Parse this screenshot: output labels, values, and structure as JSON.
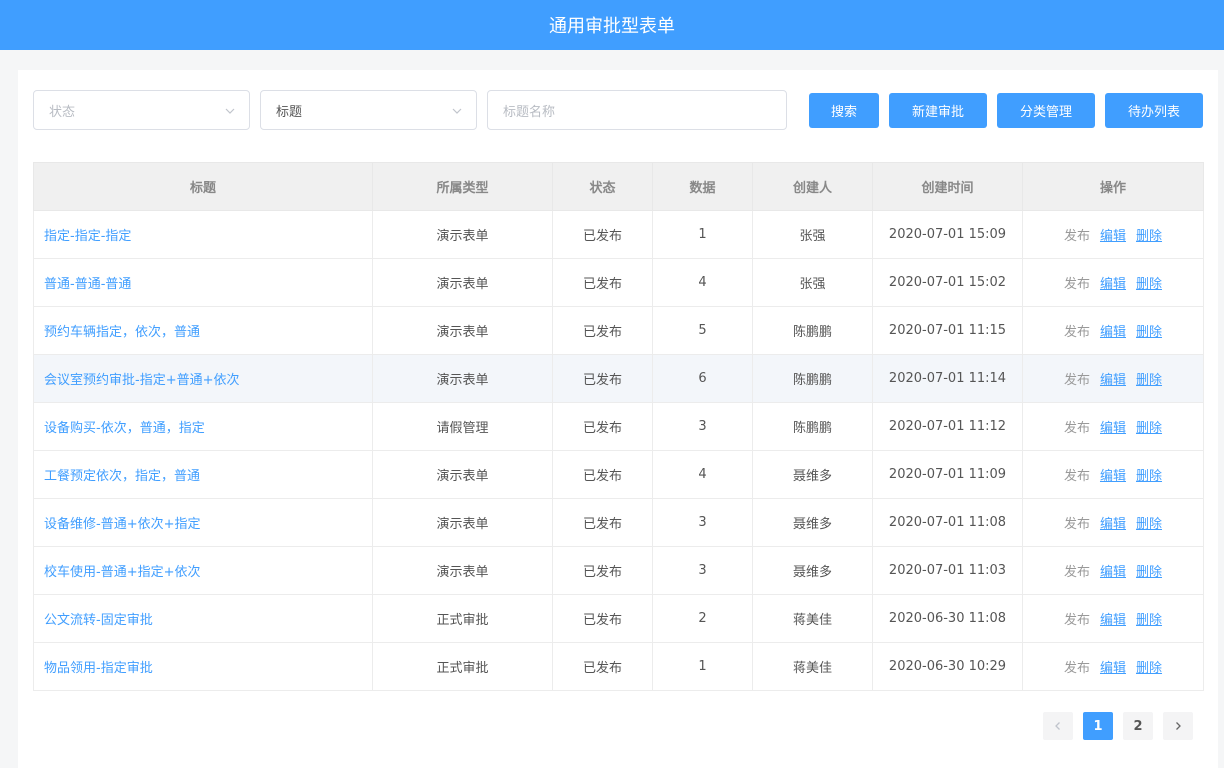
{
  "header": {
    "title": "通用审批型表单"
  },
  "filters": {
    "status_placeholder": "状态",
    "field_value": "标题",
    "keyword_placeholder": "标题名称"
  },
  "buttons": {
    "search": "搜索",
    "new_approval": "新建审批",
    "category_manage": "分类管理",
    "todo_list": "待办列表"
  },
  "table": {
    "columns": [
      "标题",
      "所属类型",
      "状态",
      "数据",
      "创建人",
      "创建时间",
      "操作"
    ],
    "rows": [
      {
        "title": "指定-指定-指定",
        "type": "演示表单",
        "status": "已发布",
        "count": "1",
        "creator": "张强",
        "created": "2020-07-01 15:09",
        "op_publish": "发布",
        "op_edit": "编辑",
        "op_delete": "删除"
      },
      {
        "title": "普通-普通-普通",
        "type": "演示表单",
        "status": "已发布",
        "count": "4",
        "creator": "张强",
        "created": "2020-07-01 15:02",
        "op_publish": "发布",
        "op_edit": "编辑",
        "op_delete": "删除"
      },
      {
        "title": "预约车辆指定，依次，普通",
        "type": "演示表单",
        "status": "已发布",
        "count": "5",
        "creator": "陈鹏鹏",
        "created": "2020-07-01 11:15",
        "op_publish": "发布",
        "op_edit": "编辑",
        "op_delete": "删除"
      },
      {
        "title": "会议室预约审批-指定+普通+依次",
        "type": "演示表单",
        "status": "已发布",
        "count": "6",
        "creator": "陈鹏鹏",
        "created": "2020-07-01 11:14",
        "op_publish": "发布",
        "op_edit": "编辑",
        "op_delete": "删除"
      },
      {
        "title": "设备购买-依次，普通，指定",
        "type": "请假管理",
        "status": "已发布",
        "count": "3",
        "creator": "陈鹏鹏",
        "created": "2020-07-01 11:12",
        "op_publish": "发布",
        "op_edit": "编辑",
        "op_delete": "删除"
      },
      {
        "title": "工餐预定依次，指定，普通",
        "type": "演示表单",
        "status": "已发布",
        "count": "4",
        "creator": "聂维多",
        "created": "2020-07-01 11:09",
        "op_publish": "发布",
        "op_edit": "编辑",
        "op_delete": "删除"
      },
      {
        "title": "设备维修-普通+依次+指定",
        "type": "演示表单",
        "status": "已发布",
        "count": "3",
        "creator": "聂维多",
        "created": "2020-07-01 11:08",
        "op_publish": "发布",
        "op_edit": "编辑",
        "op_delete": "删除"
      },
      {
        "title": "校车使用-普通+指定+依次",
        "type": "演示表单",
        "status": "已发布",
        "count": "3",
        "creator": "聂维多",
        "created": "2020-07-01 11:03",
        "op_publish": "发布",
        "op_edit": "编辑",
        "op_delete": "删除"
      },
      {
        "title": "公文流转-固定审批",
        "type": "正式审批",
        "status": "已发布",
        "count": "2",
        "creator": "蒋美佳",
        "created": "2020-06-30 11:08",
        "op_publish": "发布",
        "op_edit": "编辑",
        "op_delete": "删除"
      },
      {
        "title": "物品领用-指定审批",
        "type": "正式审批",
        "status": "已发布",
        "count": "1",
        "creator": "蒋美佳",
        "created": "2020-06-30 10:29",
        "op_publish": "发布",
        "op_edit": "编辑",
        "op_delete": "删除"
      }
    ],
    "highlighted_row": 3
  },
  "pagination": {
    "prev_icon": "chevron-left-icon",
    "next_icon": "chevron-right-icon",
    "pages": [
      "1",
      "2"
    ],
    "current": "1"
  },
  "colors": {
    "primary": "#409eff",
    "status_published": "#19be6b"
  }
}
